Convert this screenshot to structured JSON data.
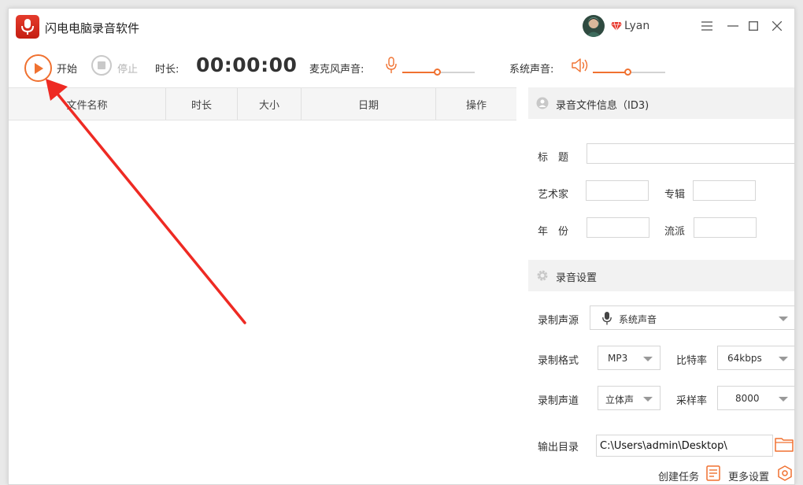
{
  "app": {
    "title": "闪电电脑录音软件",
    "username": "Lyan",
    "accent_color": "#f07130",
    "logo_color": "#d22a1c"
  },
  "toolbar": {
    "start_label": "开始",
    "stop_label": "停止",
    "duration_label": "时长:",
    "timer": "00:00:00",
    "mic_label": "麦克风声音:",
    "system_label": "系统声音:",
    "mic_volume_percent": 48,
    "system_volume_percent": 48
  },
  "file_table": {
    "columns": [
      "文件名称",
      "时长",
      "大小",
      "日期",
      "操作"
    ],
    "rows": []
  },
  "id3": {
    "section_title": "录音文件信息（ID3)",
    "title_label": "标　题",
    "artist_label": "艺术家",
    "album_label": "专辑",
    "year_label": "年　份",
    "genre_label": "流派",
    "title_value": "",
    "artist_value": "",
    "album_value": "",
    "year_value": "",
    "genre_value": ""
  },
  "settings": {
    "section_title": "录音设置",
    "source_label": "录制声源",
    "source_value": "系统声音",
    "format_label": "录制格式",
    "format_value": "MP3",
    "bitrate_label": "比特率",
    "bitrate_value": "64kbps",
    "channel_label": "录制声道",
    "channel_value": "立体声",
    "samplerate_label": "采样率",
    "samplerate_value": "8000",
    "output_label": "输出目录",
    "output_value": "C:\\Users\\admin\\Desktop\\",
    "create_task_label": "创建任务",
    "more_settings_label": "更多设置"
  }
}
